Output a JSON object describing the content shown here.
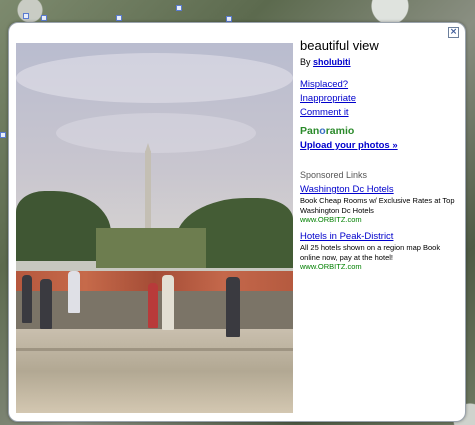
{
  "info_window": {
    "title": "beautiful view",
    "by_label": "By",
    "author": "sholubiti",
    "links": {
      "misplaced": "Misplaced?",
      "inappropriate": "Inappropriate",
      "comment": "Comment it"
    },
    "brand": {
      "pre": "Pan",
      "o": "o",
      "post": "ramio"
    },
    "upload_label": "Upload your photos »",
    "close_symbol": "×"
  },
  "sponsored": {
    "heading": "Sponsored Links",
    "ads": [
      {
        "title": "Washington Dc Hotels",
        "description": "Book Cheap Rooms w/ Exclusive Rates at Top Washington Dc Hotels",
        "url": "www.ORBITZ.com"
      },
      {
        "title": "Hotels in Peak-District",
        "description": "All 25 hotels shown on a region map Book online now, pay at the hotel!",
        "url": "www.ORBITZ.com"
      }
    ]
  }
}
